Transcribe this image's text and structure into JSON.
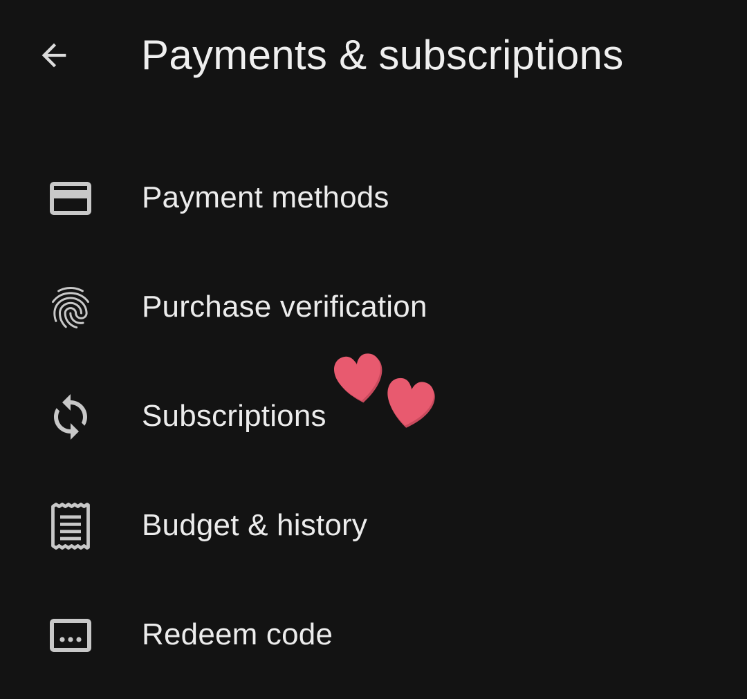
{
  "header": {
    "title": "Payments & subscriptions",
    "back_icon": "arrow-back-icon"
  },
  "menu": {
    "items": [
      {
        "id": "payment-methods",
        "label": "Payment methods",
        "icon": "credit-card-icon"
      },
      {
        "id": "purchase-verification",
        "label": "Purchase verification",
        "icon": "fingerprint-icon"
      },
      {
        "id": "subscriptions",
        "label": "Subscriptions",
        "icon": "sync-icon"
      },
      {
        "id": "budget-history",
        "label": "Budget & history",
        "icon": "receipt-icon"
      },
      {
        "id": "redeem-code",
        "label": "Redeem code",
        "icon": "redeem-code-icon"
      }
    ]
  },
  "decoration": {
    "sticker": "hearts-sticker",
    "heart_color": "#e85a6f"
  },
  "theme": {
    "background": "#131313",
    "text": "#ececec",
    "icon": "#c8c8c8"
  }
}
